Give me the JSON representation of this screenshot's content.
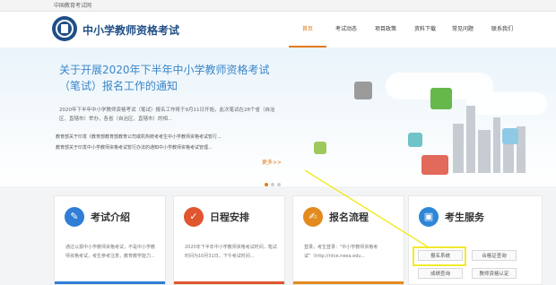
{
  "topbar": {
    "text": "中国教育考试网"
  },
  "header": {
    "title": "中小学教师资格考试",
    "nav": [
      {
        "label": "首页",
        "active": true
      },
      {
        "label": "考试动态"
      },
      {
        "label": "项目政策"
      },
      {
        "label": "资料下载"
      },
      {
        "label": "常见问题"
      },
      {
        "label": "联系我们"
      }
    ]
  },
  "banner": {
    "headline": "关于开展2020年下半年中小学教师资格考试（笔试）报名工作的通知",
    "paragraph": "2020年下半年中小学教师资格考试（笔试）报名工作将于9月11日开始，此次笔试在28个省（自治区、直辖市）举办，各省（自治区、直辖市）的相...",
    "bullets": [
      "教育部关于印发《教育部教育部教育公司或机构统考考生中小学教师资格考试暂行...",
      "教育部关于印发中小学教师资格考试暂行办法的通知中小学教师资格考试管理..."
    ],
    "more": "更多>>"
  },
  "cards": [
    {
      "title": "考试介绍",
      "icon": "pencil-icon",
      "color": "#2f7dd6",
      "text": "通过以报中小学教师资格考试，不是中小学教师资格考试，考生参考注意，教育教学能力..."
    },
    {
      "title": "日程安排",
      "icon": "checkmark-icon",
      "color": "#e0562f",
      "text": "2020年下半年中小学教师资格考试时间，笔试时间为10月31日，下午考试时间..."
    },
    {
      "title": "报名流程",
      "icon": "edit-form-icon",
      "color": "#e38a1f",
      "text": "登录，考生登录：\"中小学教师资格考试\"（http://ntce.neea.edu..."
    },
    {
      "title": "考生服务",
      "icon": "id-card-icon",
      "color": "#2f86d6",
      "text": "",
      "buttons": [
        "报名系统",
        "合格证查询",
        "成绩查询",
        "教师资格认定"
      ]
    }
  ],
  "colors": {
    "accent": "#e37b18",
    "brand": "#1f4f87",
    "highlight": "#f2ea2b"
  }
}
